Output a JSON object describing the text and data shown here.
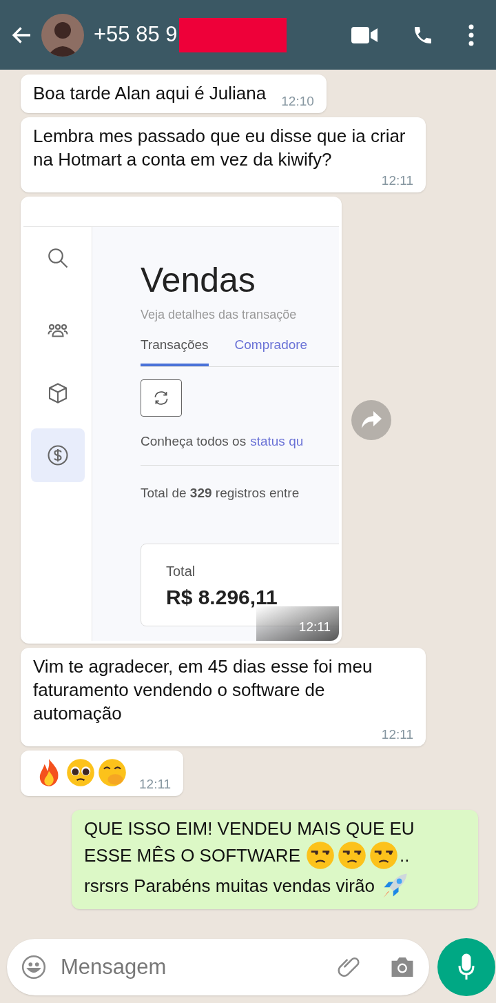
{
  "header": {
    "contact": "+55 85 9"
  },
  "messages": [
    {
      "kind": "received",
      "time": "12:10",
      "lines": [
        [
          {
            "kind": "text",
            "text": "Boa tarde Alan aqui é Juliana"
          }
        ]
      ]
    },
    {
      "kind": "received",
      "time": "12:11",
      "lines": [
        [
          {
            "kind": "text",
            "text": "Lembra mes passado que eu disse que ia criar na Hotmart a conta em vez da kiwify?"
          }
        ]
      ]
    },
    {
      "kind": "image",
      "time": "12:11",
      "screenshot": {
        "sidebar": [
          {
            "selected": false
          },
          {
            "selected": false
          },
          {
            "selected": false
          },
          {
            "selected": true
          }
        ],
        "title": "Vendas",
        "subtitle": "Veja detalhes das transaçõe",
        "tabs": [
          {
            "label": "Transações",
            "selected": true
          },
          {
            "label": "Compradore",
            "selected": false
          }
        ],
        "notice": "Conheça todos os",
        "notice_link": "status qu",
        "summary": "Total de **329** registros entre",
        "card": {
          "label": "Total",
          "value": "R$ 8.296,11"
        }
      }
    },
    {
      "kind": "received",
      "time": "12:11",
      "lines": [
        [
          {
            "kind": "text",
            "text": "Vim te agradecer, em 45 dias esse foi meu faturamento vendendo o software de automação"
          }
        ]
      ]
    },
    {
      "kind": "received",
      "time": "12:11",
      "lines": [
        [
          {
            "kind": "fire"
          },
          {
            "kind": "pleading"
          },
          {
            "kind": "covering"
          }
        ]
      ]
    },
    {
      "kind": "sent",
      "lines": [
        [
          {
            "kind": "text",
            "text": "QUE ISSO EIM! VENDEU MAIS QUE EU"
          }
        ],
        [
          {
            "kind": "text",
            "text": "ESSE MÊS O SOFTWARE"
          },
          {
            "kind": "unamused"
          },
          {
            "kind": "unamused"
          },
          {
            "kind": "unamused"
          },
          {
            "kind": "text",
            "text": ".."
          }
        ],
        [
          {
            "kind": "text",
            "text": "rsrsrs Parabéns muitas vendas virão"
          },
          {
            "kind": "rocket"
          }
        ]
      ]
    }
  ],
  "composer": {
    "placeholder": "Mensagem"
  }
}
